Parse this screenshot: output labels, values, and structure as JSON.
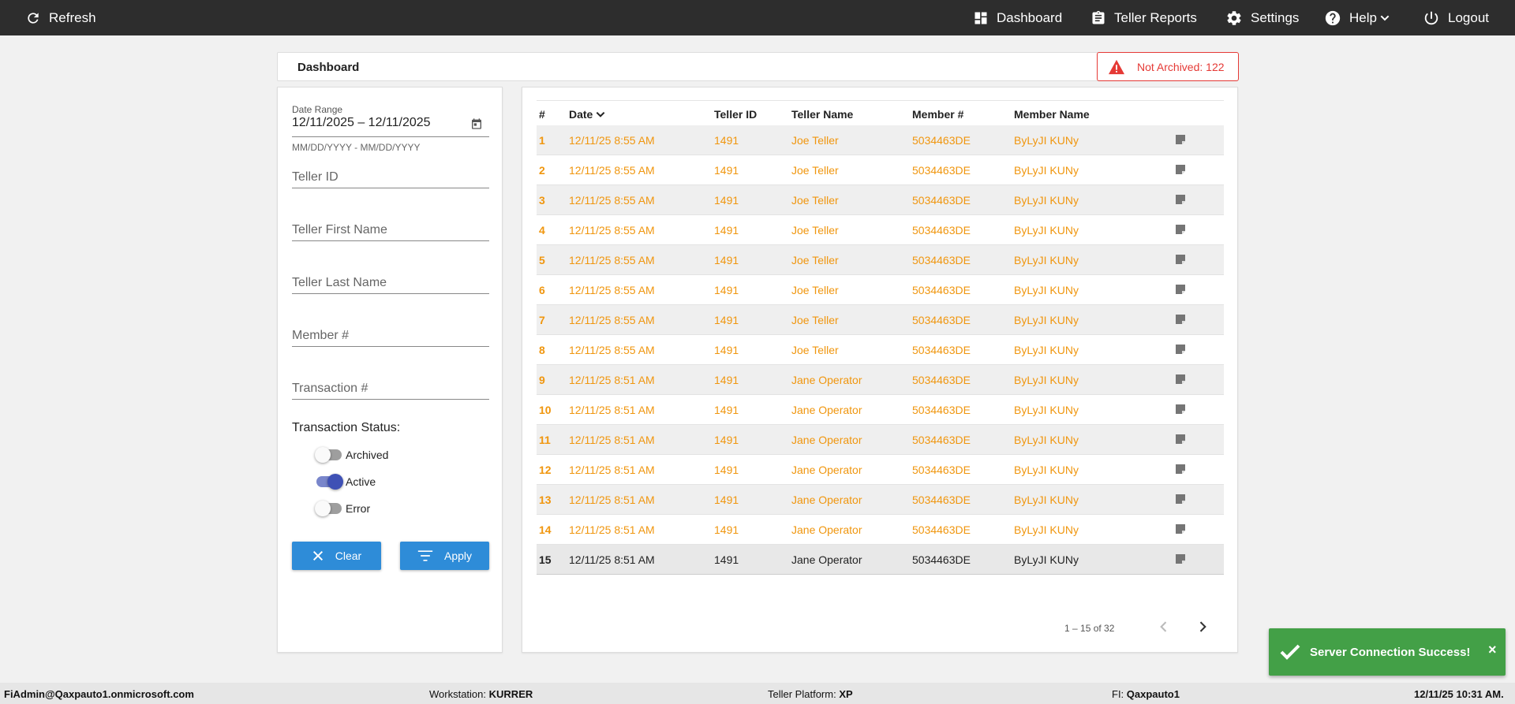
{
  "topbar": {
    "refresh": "Refresh",
    "dashboard": "Dashboard",
    "teller_reports": "Teller Reports",
    "settings": "Settings",
    "help": "Help",
    "logout": "Logout"
  },
  "header": {
    "title": "Dashboard",
    "not_archived": "Not Archived: 122"
  },
  "filters": {
    "date_range_label": "Date Range",
    "date_range_value": "12/11/2025 – 12/11/2025",
    "date_hint": "MM/DD/YYYY - MM/DD/YYYY",
    "teller_id_placeholder": "Teller ID",
    "teller_first_name_placeholder": "Teller First Name",
    "teller_last_name_placeholder": "Teller Last Name",
    "member_placeholder": "Member #",
    "transaction_placeholder": "Transaction #",
    "status_title": "Transaction Status:",
    "toggles": [
      {
        "label": "Archived",
        "on": false
      },
      {
        "label": "Active",
        "on": true
      },
      {
        "label": "Error",
        "on": false
      }
    ],
    "clear": "Clear",
    "apply": "Apply"
  },
  "table": {
    "headers": [
      "#",
      "Date",
      "Teller ID",
      "Teller Name",
      "Member #",
      "Member Name"
    ],
    "rows": [
      {
        "num": "1",
        "date": "12/11/25 8:55 AM",
        "teller_id": "1491",
        "teller_name": "Joe Teller",
        "member_num": "5034463DE",
        "member_name": "ByLyJI KUNy"
      },
      {
        "num": "2",
        "date": "12/11/25 8:55 AM",
        "teller_id": "1491",
        "teller_name": "Joe Teller",
        "member_num": "5034463DE",
        "member_name": "ByLyJI KUNy"
      },
      {
        "num": "3",
        "date": "12/11/25 8:55 AM",
        "teller_id": "1491",
        "teller_name": "Joe Teller",
        "member_num": "5034463DE",
        "member_name": "ByLyJI KUNy"
      },
      {
        "num": "4",
        "date": "12/11/25 8:55 AM",
        "teller_id": "1491",
        "teller_name": "Joe Teller",
        "member_num": "5034463DE",
        "member_name": "ByLyJI KUNy"
      },
      {
        "num": "5",
        "date": "12/11/25 8:55 AM",
        "teller_id": "1491",
        "teller_name": "Joe Teller",
        "member_num": "5034463DE",
        "member_name": "ByLyJI KUNy"
      },
      {
        "num": "6",
        "date": "12/11/25 8:55 AM",
        "teller_id": "1491",
        "teller_name": "Joe Teller",
        "member_num": "5034463DE",
        "member_name": "ByLyJI KUNy"
      },
      {
        "num": "7",
        "date": "12/11/25 8:55 AM",
        "teller_id": "1491",
        "teller_name": "Joe Teller",
        "member_num": "5034463DE",
        "member_name": "ByLyJI KUNy"
      },
      {
        "num": "8",
        "date": "12/11/25 8:55 AM",
        "teller_id": "1491",
        "teller_name": "Joe Teller",
        "member_num": "5034463DE",
        "member_name": "ByLyJI KUNy"
      },
      {
        "num": "9",
        "date": "12/11/25 8:51 AM",
        "teller_id": "1491",
        "teller_name": "Jane Operator",
        "member_num": "5034463DE",
        "member_name": "ByLyJI KUNy"
      },
      {
        "num": "10",
        "date": "12/11/25 8:51 AM",
        "teller_id": "1491",
        "teller_name": "Jane Operator",
        "member_num": "5034463DE",
        "member_name": "ByLyJI KUNy"
      },
      {
        "num": "11",
        "date": "12/11/25 8:51 AM",
        "teller_id": "1491",
        "teller_name": "Jane Operator",
        "member_num": "5034463DE",
        "member_name": "ByLyJI KUNy"
      },
      {
        "num": "12",
        "date": "12/11/25 8:51 AM",
        "teller_id": "1491",
        "teller_name": "Jane Operator",
        "member_num": "5034463DE",
        "member_name": "ByLyJI KUNy"
      },
      {
        "num": "13",
        "date": "12/11/25 8:51 AM",
        "teller_id": "1491",
        "teller_name": "Jane Operator",
        "member_num": "5034463DE",
        "member_name": "ByLyJI KUNy"
      },
      {
        "num": "14",
        "date": "12/11/25 8:51 AM",
        "teller_id": "1491",
        "teller_name": "Jane Operator",
        "member_num": "5034463DE",
        "member_name": "ByLyJI KUNy"
      },
      {
        "num": "15",
        "date": "12/11/25 8:51 AM",
        "teller_id": "1491",
        "teller_name": "Jane Operator",
        "member_num": "5034463DE",
        "member_name": "ByLyJI KUNy"
      }
    ],
    "pagination": "1 – 15 of 32"
  },
  "toast": {
    "message": "Server Connection Success!",
    "close": "×"
  },
  "statusbar": {
    "user": "FiAdmin@Qaxpauto1.onmicrosoft.com",
    "workstation_label": "Workstation:",
    "workstation": "KURRER",
    "platform_label": "Teller Platform:",
    "platform": "XP",
    "fi_label": "FI:",
    "fi": "Qaxpauto1",
    "datetime": "12/11/25 10:31 AM."
  },
  "colors": {
    "topbar": "#2d2d2d",
    "accent_blue": "#2e8cd8",
    "row_text": "#f0960e",
    "alert_red": "#e53935",
    "toast_green": "#43a047",
    "toggle_on": "#3f51b5"
  }
}
